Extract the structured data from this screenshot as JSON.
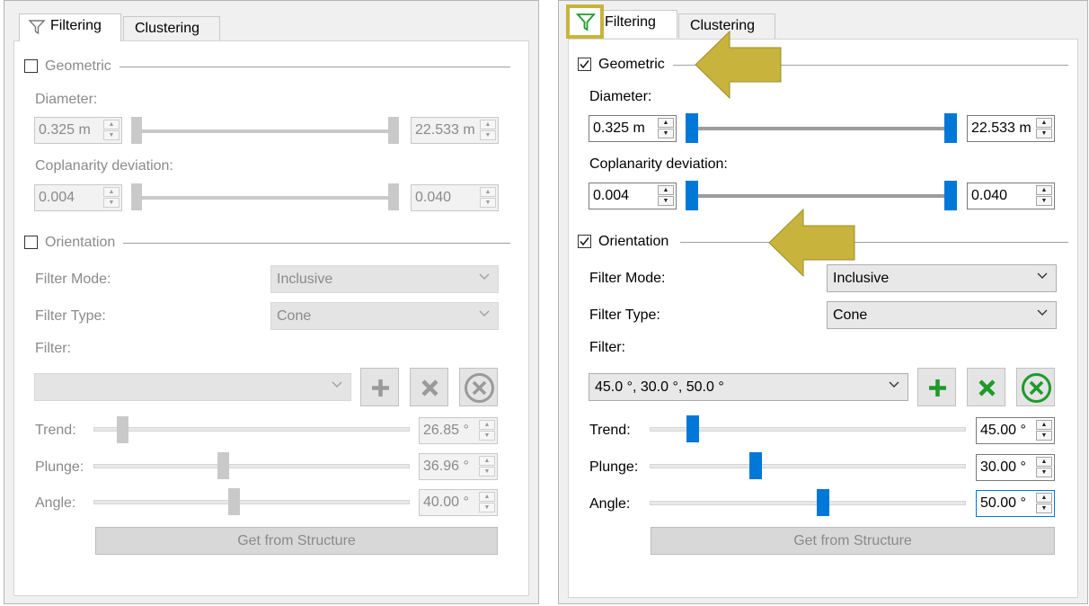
{
  "left_panel": {
    "tabs": [
      {
        "label": "Filtering"
      },
      {
        "label": "Clustering"
      }
    ],
    "geometric": {
      "label": "Geometric",
      "diameter_label": "Diameter:",
      "diameter_min": "0.325 m",
      "diameter_max": "22.533 m",
      "coplanarity_label": "Coplanarity deviation:",
      "coplanarity_min": "0.004",
      "coplanarity_max": "0.040"
    },
    "orientation": {
      "label": "Orientation",
      "filter_mode_label": "Filter Mode:",
      "filter_mode_value": "Inclusive",
      "filter_type_label": "Filter Type:",
      "filter_type_value": "Cone",
      "filter_label": "Filter:",
      "filter_value": "",
      "trend_label": "Trend:",
      "trend_value": "26.85 °",
      "plunge_label": "Plunge:",
      "plunge_value": "36.96 °",
      "angle_label": "Angle:",
      "angle_value": "40.00 °",
      "get_button": "Get from Structure"
    }
  },
  "right_panel": {
    "tabs": [
      {
        "label": "Filtering"
      },
      {
        "label": "Clustering"
      }
    ],
    "geometric": {
      "label": "Geometric",
      "diameter_label": "Diameter:",
      "diameter_min": "0.325 m",
      "diameter_max": "22.533 m",
      "coplanarity_label": "Coplanarity deviation:",
      "coplanarity_min": "0.004",
      "coplanarity_max": "0.040"
    },
    "orientation": {
      "label": "Orientation",
      "filter_mode_label": "Filter Mode:",
      "filter_mode_value": "Inclusive",
      "filter_type_label": "Filter Type:",
      "filter_type_value": "Cone",
      "filter_label": "Filter:",
      "filter_value": "45.0 °, 30.0 °, 50.0 °",
      "trend_label": "Trend:",
      "trend_value": "45.00 °",
      "plunge_label": "Plunge:",
      "plunge_value": "30.00 °",
      "angle_label": "Angle:",
      "angle_value": "50.00 °",
      "get_button": "Get from Structure"
    }
  },
  "colors": {
    "accent": "#0078d7",
    "highlight": "#c8b43c",
    "add_green": "#1e9a2a"
  },
  "icons": {
    "filter_tab": "funnel-icon",
    "add": "plus-icon",
    "remove": "x-icon",
    "clear": "circle-x-icon"
  }
}
